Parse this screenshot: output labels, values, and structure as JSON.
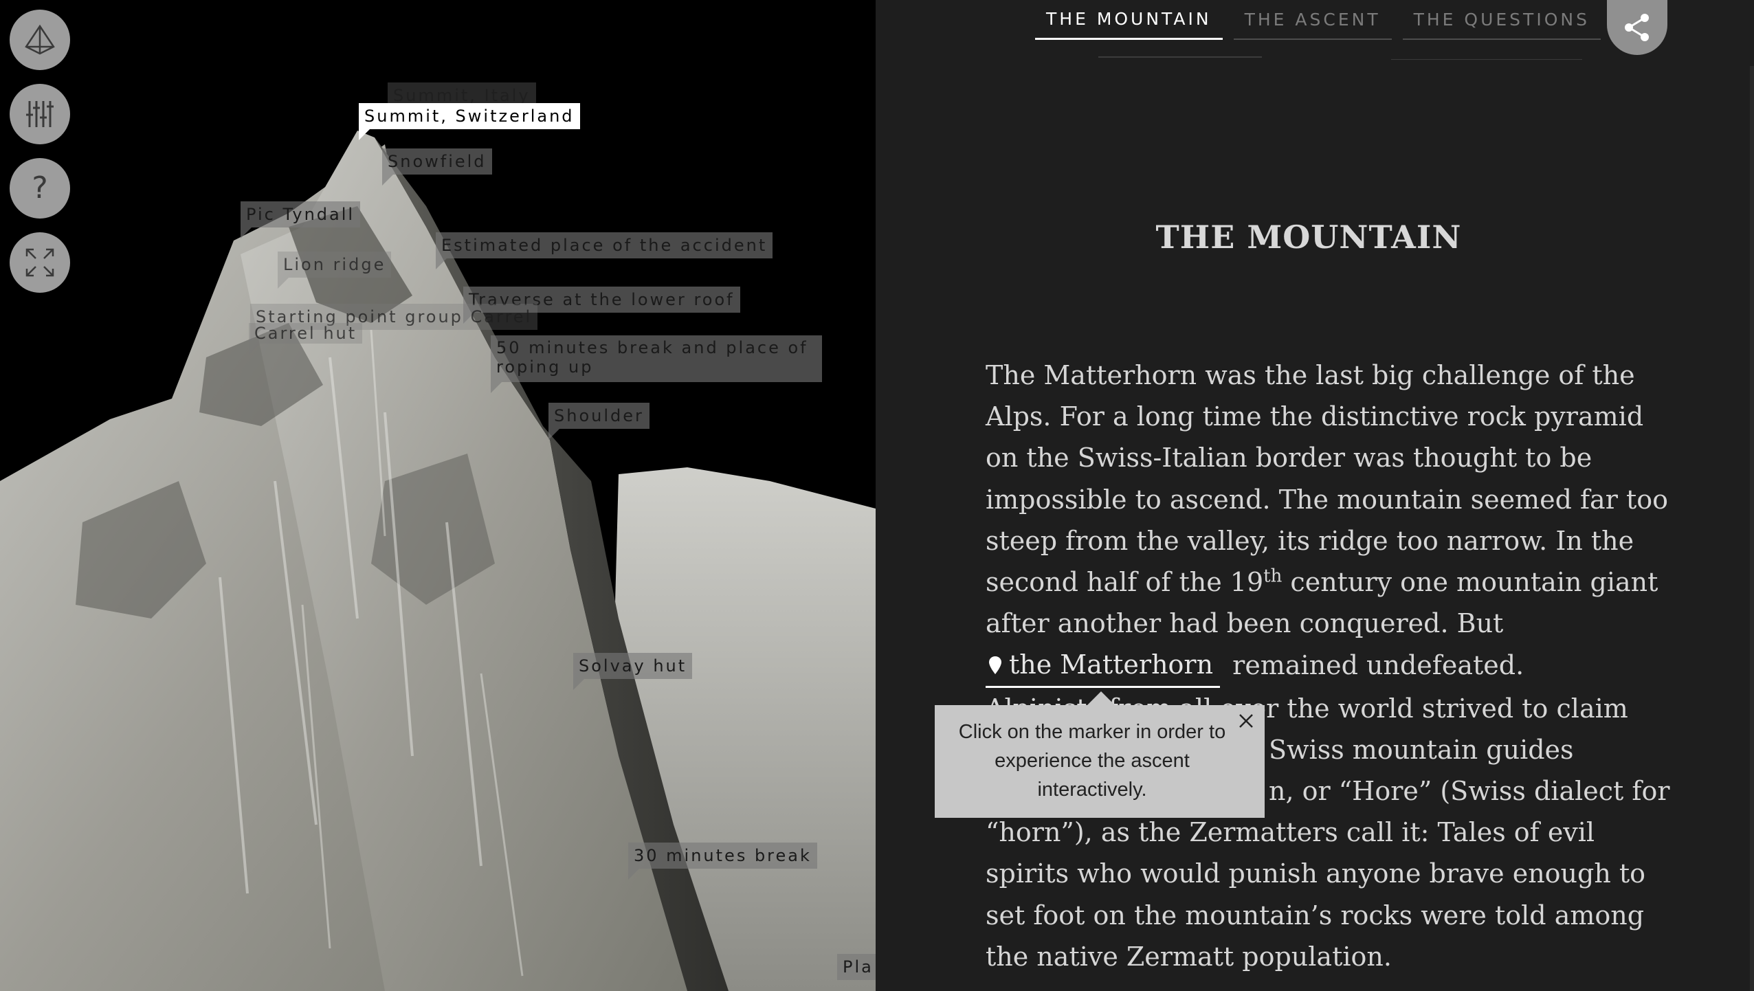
{
  "controls": [
    {
      "icon": "pyramid-view-icon"
    },
    {
      "icon": "sliders-icon"
    },
    {
      "icon": "help-icon",
      "symbol": "?"
    },
    {
      "icon": "fullscreen-icon"
    }
  ],
  "markers": {
    "summit_italy": "Summit, Italy",
    "summit_switzerland": "Summit, Switzerland",
    "snowfield": "Snowfield",
    "pic_tyndall": "Pic Tyndall",
    "lion_ridge": "Lion ridge",
    "accident": "Estimated place of the accident",
    "traverse": "Traverse at the lower roof",
    "starting_point": "Starting point group Carrel",
    "carrel_hut": "Carrel hut",
    "break_50": "50 minutes break and place of roping up",
    "shoulder": "Shoulder",
    "solvay": "Solvay hut",
    "break_30": "30 minutes break",
    "partial_bottom": "Pla"
  },
  "tabs": [
    {
      "label": "THE MOUNTAIN",
      "active": true
    },
    {
      "label": "THE ASCENT",
      "active": false
    },
    {
      "label": "THE QUESTIONS",
      "active": false
    }
  ],
  "share": {
    "icon": "share-icon"
  },
  "article": {
    "title": "THE MOUNTAIN",
    "p1_a": "The Matterhorn was the last big challenge of the Alps. For a long time the distinctive rock pyramid on the Swiss-Italian border was thought to be impossible to ascend. The mountain seemed far too steep from the valley, its ridge too narrow. In the second half of the 19",
    "p1_sup": "th",
    "p1_b": " century one mountain giant after another had been conquered. But",
    "marker_link": "the Matterhorn",
    "p1_c": "remained undefeated.",
    "p2_a": "Alpinists from all over the world strived to claim",
    "p2_b": "Swiss mountain guides",
    "p2_c": "n, or “Hore” (Swiss dialect for “horn”), as the Zermatters call it: Tales of evil spirits who would punish anyone brave enough to set foot on the mountain’s rocks were told among the native Zermatt population."
  },
  "tooltip": {
    "text": "Click on the marker in order to experience the ascent interactively.",
    "close_icon": "close-icon"
  },
  "colors": {
    "panel_bg": "#1e1e1e",
    "viewport_bg": "#000000",
    "tab_active": "#ffffff",
    "tab_inactive": "#7b7b7b",
    "marker_bg": "#787878",
    "tooltip_bg": "#c7c7c7"
  }
}
